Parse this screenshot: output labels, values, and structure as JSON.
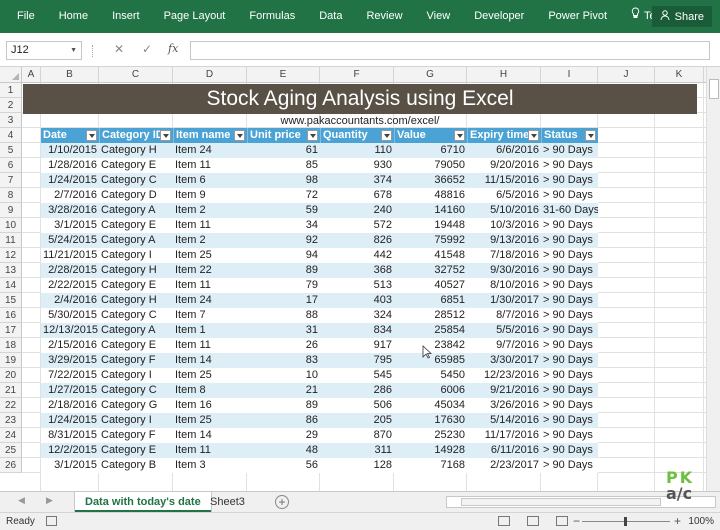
{
  "ribbon": {
    "tabs": [
      "File",
      "Home",
      "Insert",
      "Page Layout",
      "Formulas",
      "Data",
      "Review",
      "View",
      "Developer",
      "Power Pivot"
    ],
    "tell_me": "Tell me",
    "share": "Share"
  },
  "formula_bar": {
    "name_box": "J12",
    "fx": "fx",
    "formula": ""
  },
  "columns": [
    "A",
    "B",
    "C",
    "D",
    "E",
    "F",
    "G",
    "H",
    "I",
    "J",
    "K"
  ],
  "rows": [
    "1",
    "2",
    "3",
    "4",
    "5",
    "6",
    "7",
    "8",
    "9",
    "10",
    "11",
    "12",
    "13",
    "14",
    "15",
    "16",
    "17",
    "18",
    "19",
    "20",
    "21",
    "22",
    "23",
    "24",
    "25",
    "26"
  ],
  "sheet": {
    "title": "Stock Aging Analysis using Excel",
    "url": "www.pakaccountants.com/excel/",
    "headers": [
      "Date",
      "Category ID",
      "Item name",
      "Unit price",
      "Quantity",
      "Value",
      "Expiry time",
      "Status"
    ],
    "data": [
      [
        "1/10/2015",
        "Category H",
        "Item 24",
        "61",
        "110",
        "6710",
        "6/6/2016",
        "> 90 Days"
      ],
      [
        "1/28/2016",
        "Category E",
        "Item 11",
        "85",
        "930",
        "79050",
        "9/20/2016",
        "> 90 Days"
      ],
      [
        "1/24/2015",
        "Category C",
        "Item 6",
        "98",
        "374",
        "36652",
        "11/15/2016",
        "> 90 Days"
      ],
      [
        "2/7/2016",
        "Category D",
        "Item 9",
        "72",
        "678",
        "48816",
        "6/5/2016",
        "> 90 Days"
      ],
      [
        "3/28/2016",
        "Category A",
        "Item 2",
        "59",
        "240",
        "14160",
        "5/10/2016",
        "31-60 Days"
      ],
      [
        "3/1/2015",
        "Category E",
        "Item 11",
        "34",
        "572",
        "19448",
        "10/3/2016",
        "> 90 Days"
      ],
      [
        "5/24/2015",
        "Category A",
        "Item 2",
        "92",
        "826",
        "75992",
        "9/13/2016",
        "> 90 Days"
      ],
      [
        "11/21/2015",
        "Category I",
        "Item 25",
        "94",
        "442",
        "41548",
        "7/18/2016",
        "> 90 Days"
      ],
      [
        "2/28/2015",
        "Category H",
        "Item 22",
        "89",
        "368",
        "32752",
        "9/30/2016",
        "> 90 Days"
      ],
      [
        "2/22/2015",
        "Category E",
        "Item 11",
        "79",
        "513",
        "40527",
        "8/10/2016",
        "> 90 Days"
      ],
      [
        "2/4/2016",
        "Category H",
        "Item 24",
        "17",
        "403",
        "6851",
        "1/30/2017",
        "> 90 Days"
      ],
      [
        "5/30/2015",
        "Category C",
        "Item 7",
        "88",
        "324",
        "28512",
        "8/7/2016",
        "> 90 Days"
      ],
      [
        "12/13/2015",
        "Category A",
        "Item 1",
        "31",
        "834",
        "25854",
        "5/5/2016",
        "> 90 Days"
      ],
      [
        "2/15/2016",
        "Category E",
        "Item 11",
        "26",
        "917",
        "23842",
        "9/7/2016",
        "> 90 Days"
      ],
      [
        "3/29/2015",
        "Category F",
        "Item 14",
        "83",
        "795",
        "65985",
        "3/30/2017",
        "> 90 Days"
      ],
      [
        "7/22/2015",
        "Category I",
        "Item 25",
        "10",
        "545",
        "5450",
        "12/23/2016",
        "> 90 Days"
      ],
      [
        "1/27/2015",
        "Category C",
        "Item 8",
        "21",
        "286",
        "6006",
        "9/21/2016",
        "> 90 Days"
      ],
      [
        "2/18/2016",
        "Category G",
        "Item 16",
        "89",
        "506",
        "45034",
        "3/26/2016",
        "> 90 Days"
      ],
      [
        "1/24/2015",
        "Category I",
        "Item 25",
        "86",
        "205",
        "17630",
        "5/14/2016",
        "> 90 Days"
      ],
      [
        "8/31/2015",
        "Category F",
        "Item 14",
        "29",
        "870",
        "25230",
        "11/17/2016",
        "> 90 Days"
      ],
      [
        "12/2/2015",
        "Category E",
        "Item 11",
        "48",
        "311",
        "14928",
        "6/11/2016",
        "> 90 Days"
      ],
      [
        "3/1/2015",
        "Category B",
        "Item 3",
        "56",
        "128",
        "7168",
        "2/23/2017",
        "> 90 Days"
      ]
    ]
  },
  "sheet_tabs": [
    "Data with today's date",
    "Sheet3"
  ],
  "status": {
    "ready": "Ready",
    "zoom": "100%"
  },
  "logo": {
    "top": "PK",
    "bottom": "a/c"
  }
}
